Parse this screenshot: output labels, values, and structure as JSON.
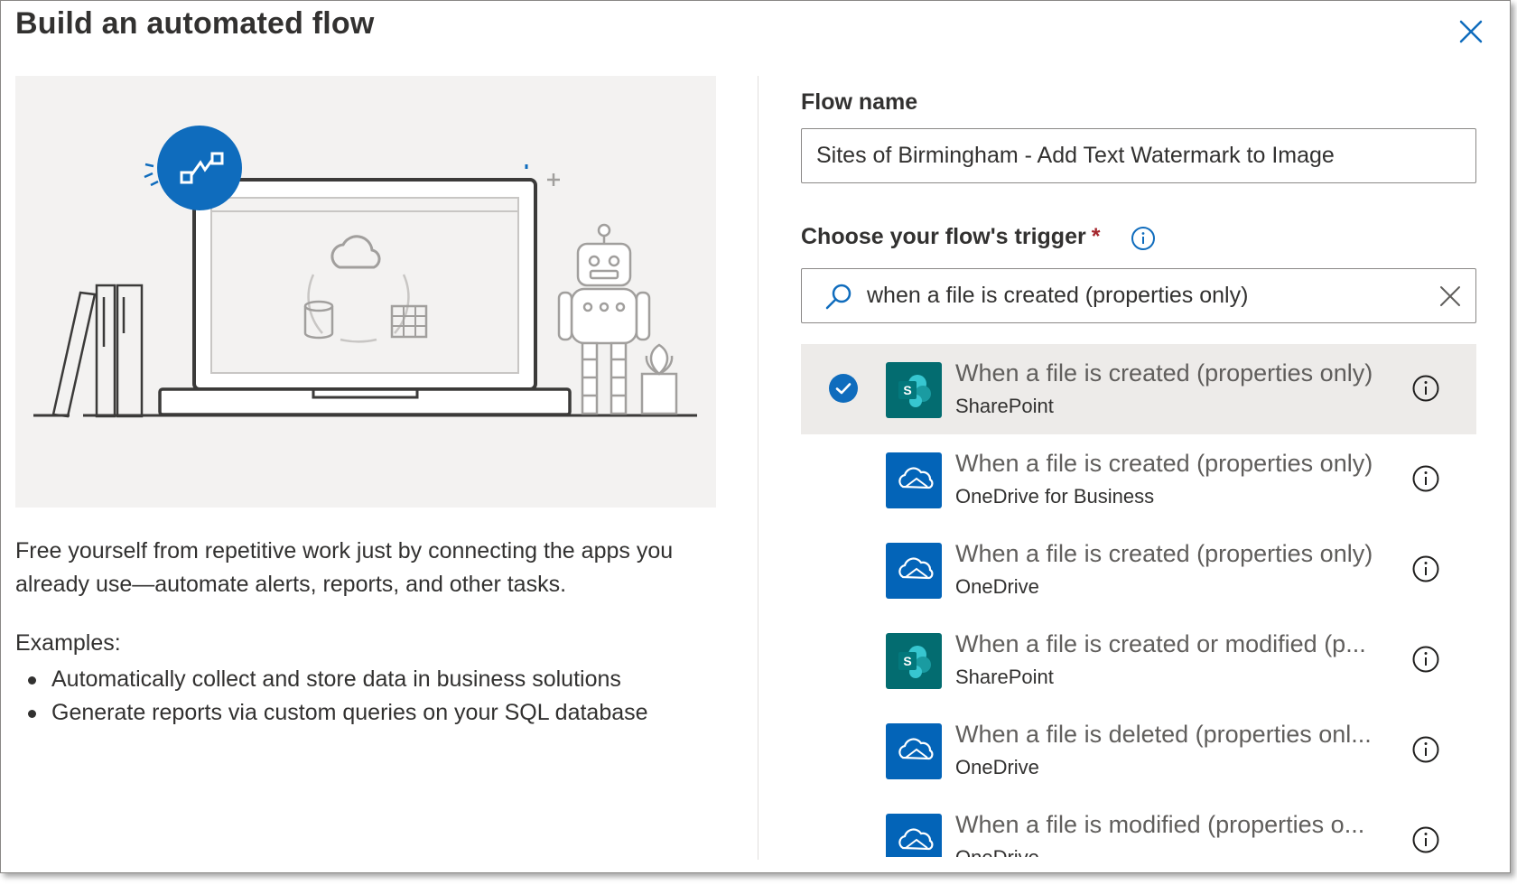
{
  "dialog": {
    "title": "Build an automated flow",
    "close_icon": "close-icon"
  },
  "left": {
    "description": "Free yourself from repetitive work just by connecting the apps you already use—automate alerts, reports, and other tasks.",
    "examples_label": "Examples:",
    "examples": [
      "Automatically collect and store data in business solutions",
      "Generate reports via custom queries on your SQL database"
    ]
  },
  "form": {
    "flow_name_label": "Flow name",
    "flow_name_value": "Sites of Birmingham - Add Text Watermark to Image",
    "trigger_label": "Choose your flow's trigger",
    "required_marker": "*",
    "search_value": "when a file is created (properties only)"
  },
  "triggers": [
    {
      "title": "When a file is created (properties only)",
      "connector": "SharePoint",
      "icon": "sharepoint-icon",
      "selected": true
    },
    {
      "title": "When a file is created (properties only)",
      "connector": "OneDrive for Business",
      "icon": "onedrive-icon",
      "selected": false
    },
    {
      "title": "When a file is created (properties only)",
      "connector": "OneDrive",
      "icon": "onedrive-icon",
      "selected": false
    },
    {
      "title": "When a file is created or modified (p...",
      "connector": "SharePoint",
      "icon": "sharepoint-icon",
      "selected": false
    },
    {
      "title": "When a file is deleted (properties onl...",
      "connector": "OneDrive",
      "icon": "onedrive-icon",
      "selected": false
    },
    {
      "title": "When a file is modified (properties o...",
      "connector": "OneDrive",
      "icon": "onedrive-icon",
      "selected": false
    }
  ],
  "colors": {
    "accent": "#0f6cbd",
    "sharepoint": "#036c70",
    "onedrive": "#0364b8",
    "selected_row": "#edebe9",
    "illustration_bg": "#f3f2f1"
  }
}
